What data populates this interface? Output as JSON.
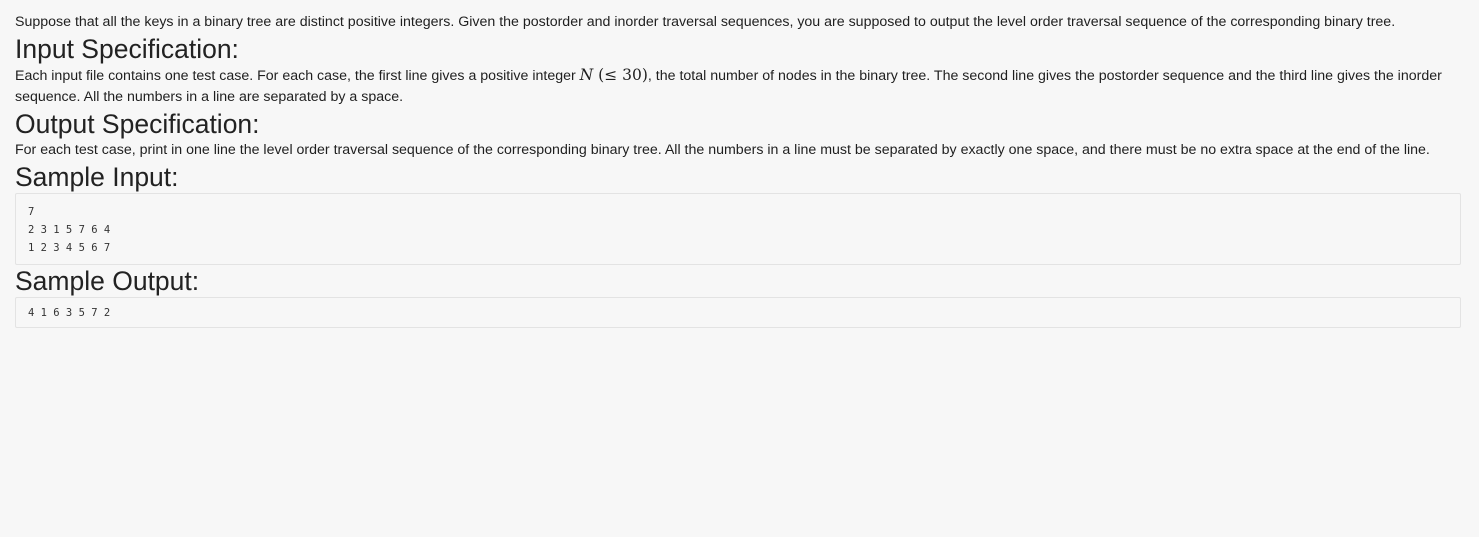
{
  "intro": "Suppose that all the keys in a binary tree are distinct positive integers. Given the postorder and inorder traversal sequences, you are supposed to output the level order traversal sequence of the corresponding binary tree.",
  "input_spec": {
    "heading": "Input Specification:",
    "text_before": "Each input file contains one test case. For each case, the first line gives a positive integer ",
    "math_var": "N",
    "math_expr": "(≤ 30)",
    "text_after": ", the total number of nodes in the binary tree. The second line gives the postorder sequence and the third line gives the inorder sequence. All the numbers in a line are separated by a space."
  },
  "output_spec": {
    "heading": "Output Specification:",
    "text": "For each test case, print in one line the level order traversal sequence of the corresponding binary tree. All the numbers in a line must be separated by exactly one space, and there must be no extra space at the end of the line."
  },
  "sample_input": {
    "heading": "Sample Input:",
    "code": "7\n2 3 1 5 7 6 4\n1 2 3 4 5 6 7"
  },
  "sample_output": {
    "heading": "Sample Output:",
    "code": "4 1 6 3 5 7 2"
  }
}
